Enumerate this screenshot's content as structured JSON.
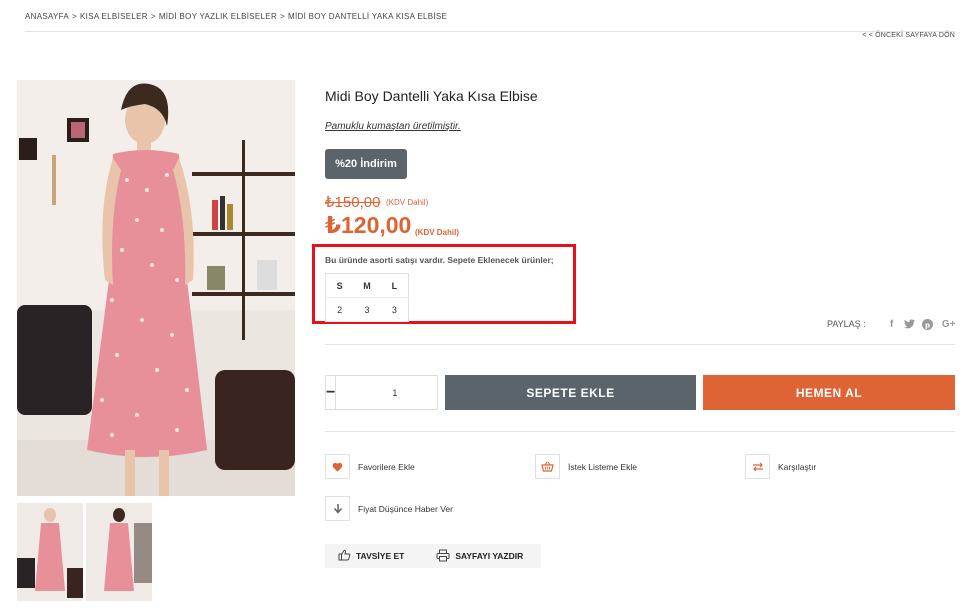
{
  "breadcrumb": {
    "items": [
      "ANASAYFA",
      "KISA ELBİSELER",
      "MİDİ BOY YAZLIK ELBİSELER",
      "MİDİ BOY DANTELLİ YAKA KISA ELBİSE"
    ],
    "separator": ">"
  },
  "back_link": "< < ÖNCEKİ SAYFAYA DÖN",
  "product": {
    "title": "Midi Boy Dantelli Yaka Kısa Elbise",
    "subtitle": "Pamuklu kumaştan üretilmiştir.",
    "discount_badge": "%20 İndirim",
    "old_price": "₺150,00",
    "old_price_vat": "(KDV Dahil)",
    "new_price": "₺120,00",
    "new_price_vat": "(KDV Dahil)"
  },
  "assortment": {
    "text": "Bu üründe asorti satışı vardır. Sepete Eklenecek ürünler;",
    "sizes": [
      "S",
      "M",
      "L"
    ],
    "quantities": [
      "2",
      "3",
      "3"
    ]
  },
  "share": {
    "label": "PAYLAŞ :",
    "icons": [
      "facebook-icon",
      "twitter-icon",
      "pinterest-icon",
      "google-plus-icon"
    ]
  },
  "cart": {
    "quantity": "1",
    "minus": "−",
    "plus": "+",
    "add_to_cart": "SEPETE EKLE",
    "buy_now": "HEMEN AL"
  },
  "actions": {
    "favorites": "Favorilere Ekle",
    "wishlist": "İstek Listeme Ekle",
    "compare": "Karşılaştır",
    "price_alert": "Fiyat Düşünce Haber Ver"
  },
  "bottom": {
    "recommend": "TAVSİYE ET",
    "print": "SAYFAYI YAZDIR"
  },
  "colors": {
    "accent_orange": "#de6436",
    "dark_gray": "#5a646a",
    "highlight_red": "#e8101b",
    "dress_pink": "#e8909a"
  }
}
